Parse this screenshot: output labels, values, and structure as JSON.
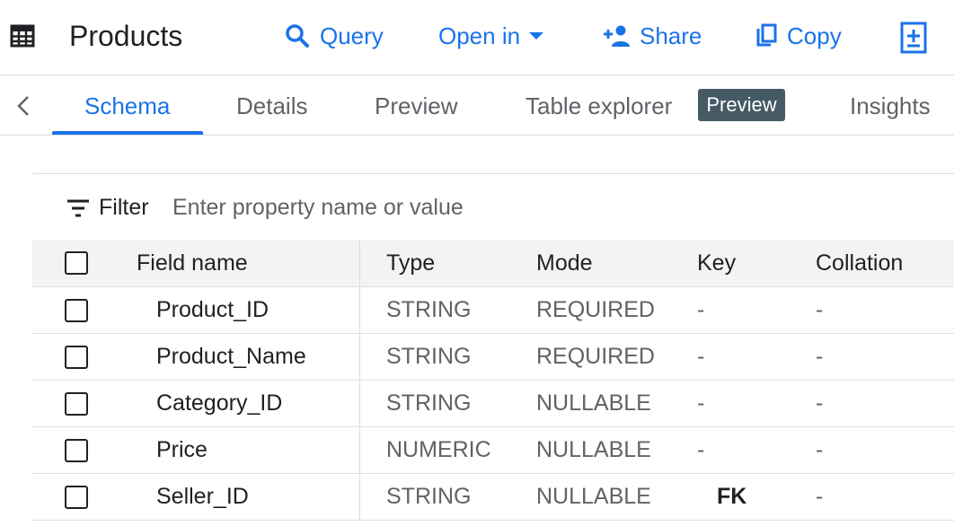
{
  "toolbar": {
    "title": "Products",
    "query_label": "Query",
    "open_in_label": "Open in",
    "share_label": "Share",
    "copy_label": "Copy"
  },
  "tabs": [
    {
      "label": "Schema",
      "active": true
    },
    {
      "label": "Details",
      "active": false
    },
    {
      "label": "Preview",
      "active": false
    },
    {
      "label": "Table explorer",
      "active": false,
      "badge": "Preview"
    },
    {
      "label": "Insights",
      "active": false
    }
  ],
  "filter": {
    "label": "Filter",
    "placeholder": "Enter property name or value"
  },
  "schema": {
    "columns": [
      "Field name",
      "Type",
      "Mode",
      "Key",
      "Collation"
    ],
    "rows": [
      {
        "name": "Product_ID",
        "type": "STRING",
        "mode": "REQUIRED",
        "key": "-",
        "collation": "-"
      },
      {
        "name": "Product_Name",
        "type": "STRING",
        "mode": "REQUIRED",
        "key": "-",
        "collation": "-"
      },
      {
        "name": "Category_ID",
        "type": "STRING",
        "mode": "NULLABLE",
        "key": "-",
        "collation": "-"
      },
      {
        "name": "Price",
        "type": "NUMERIC",
        "mode": "NULLABLE",
        "key": "-",
        "collation": "-"
      },
      {
        "name": "Seller_ID",
        "type": "STRING",
        "mode": "NULLABLE",
        "key": "FK",
        "collation": "-"
      }
    ]
  },
  "icons": {
    "table": "table-icon",
    "query": "search-icon",
    "open_in": "caret-down-icon",
    "share": "person-add-icon",
    "copy": "copy-icon",
    "add": "add-to-box-icon",
    "back": "chevron-left-icon",
    "filter": "filter-list-icon"
  },
  "colors": {
    "accent": "#1a73e8",
    "badge_bg": "#455a64",
    "header_bg": "#f1f3f4",
    "muted_text": "#5f6368"
  }
}
